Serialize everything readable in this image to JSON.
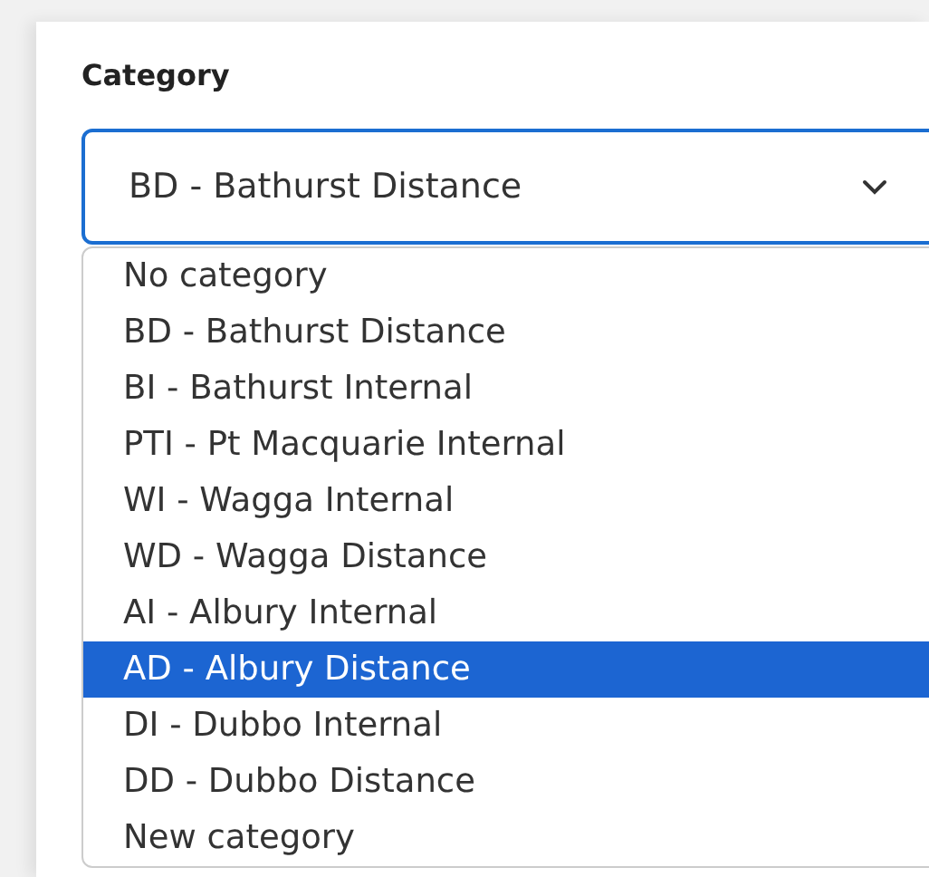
{
  "field": {
    "label": "Category",
    "value": "BD - Bathurst Distance",
    "expanded": true
  },
  "options": [
    {
      "label": "No category",
      "selected": false
    },
    {
      "label": "BD - Bathurst Distance",
      "selected": false
    },
    {
      "label": "BI - Bathurst Internal",
      "selected": false
    },
    {
      "label": "PTI - Pt Macquarie Internal",
      "selected": false
    },
    {
      "label": "WI - Wagga Internal",
      "selected": false
    },
    {
      "label": "WD - Wagga Distance",
      "selected": false
    },
    {
      "label": "AI - Albury Internal",
      "selected": false
    },
    {
      "label": "AD - Albury Distance",
      "selected": true
    },
    {
      "label": "DI - Dubbo Internal",
      "selected": false
    },
    {
      "label": "DD - Dubbo Distance",
      "selected": false
    },
    {
      "label": "New category",
      "selected": false
    }
  ]
}
